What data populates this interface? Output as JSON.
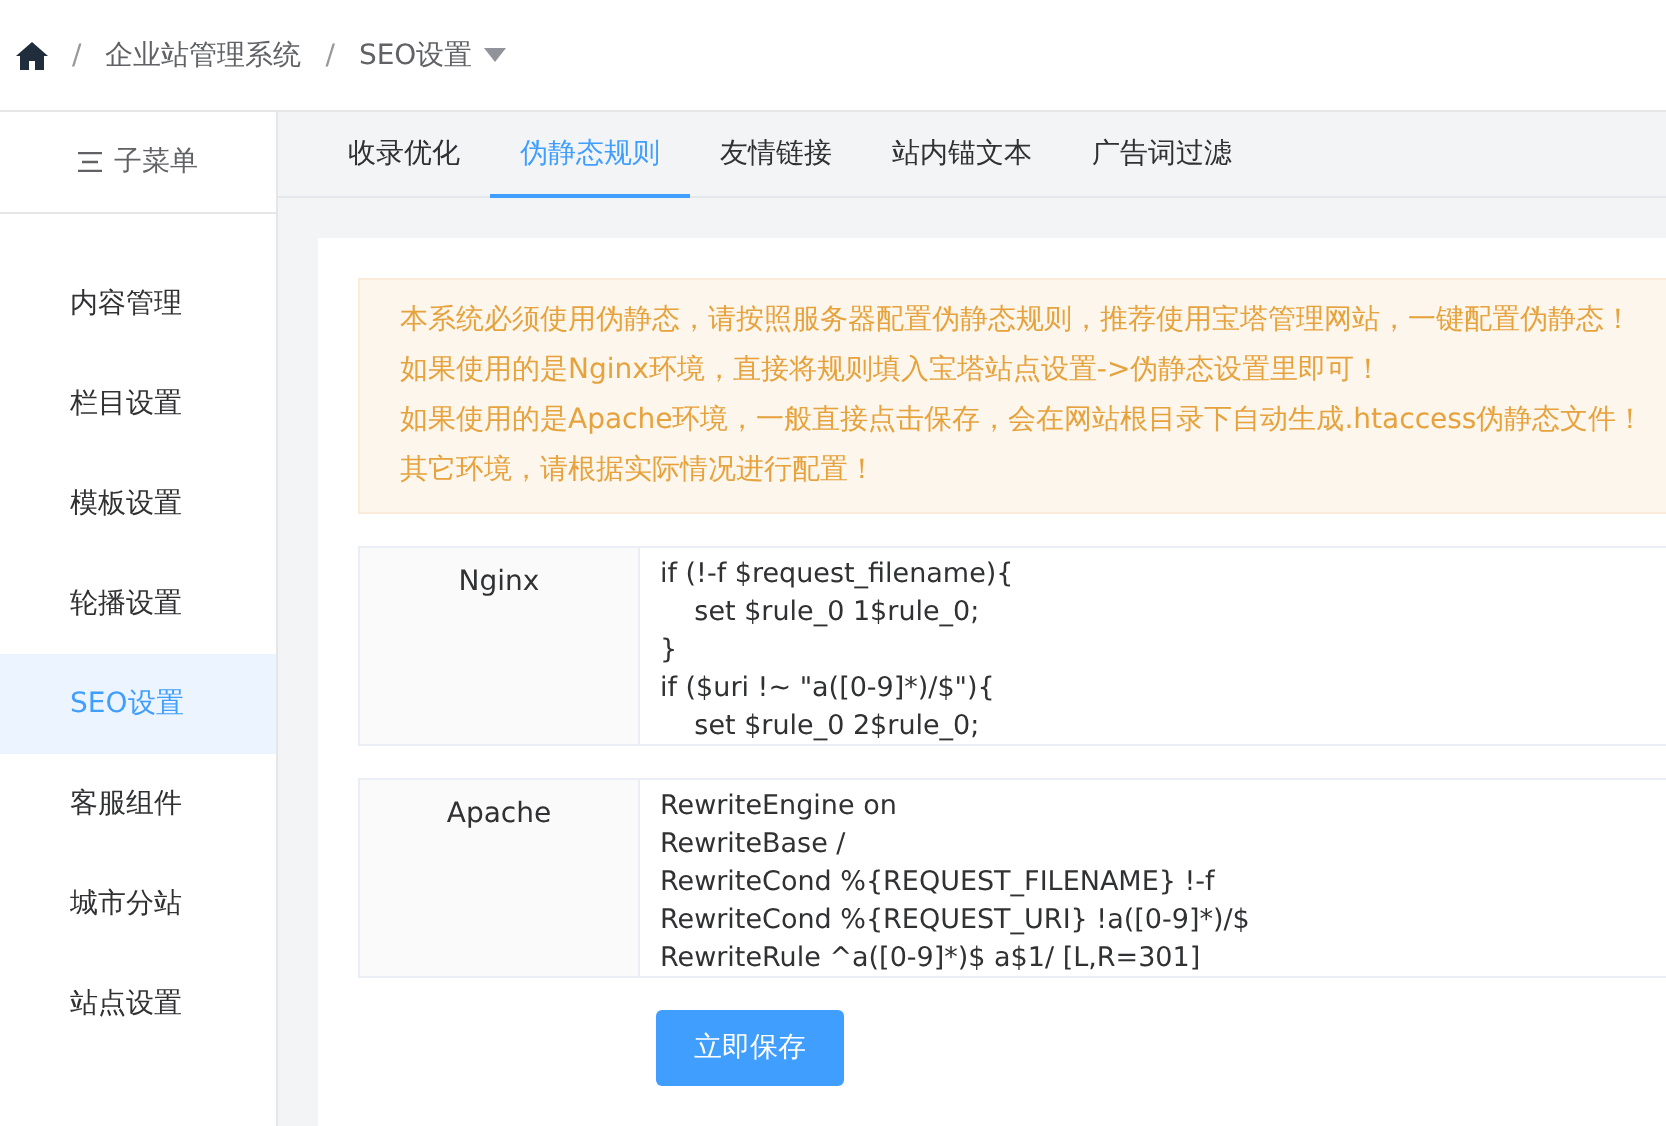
{
  "breadcrumb": {
    "items": [
      "企业站管理系统",
      "SEO设置"
    ],
    "separator": "/"
  },
  "sidebar": {
    "title": "子菜单",
    "items": [
      {
        "label": "内容管理",
        "selected": false
      },
      {
        "label": "栏目设置",
        "selected": false
      },
      {
        "label": "模板设置",
        "selected": false
      },
      {
        "label": "轮播设置",
        "selected": false
      },
      {
        "label": "SEO设置",
        "selected": true
      },
      {
        "label": "客服组件",
        "selected": false
      },
      {
        "label": "城市分站",
        "selected": false
      },
      {
        "label": "站点设置",
        "selected": false
      }
    ]
  },
  "tabs": [
    {
      "label": "收录优化",
      "selected": false
    },
    {
      "label": "伪静态规则",
      "selected": true
    },
    {
      "label": "友情链接",
      "selected": false
    },
    {
      "label": "站内锚文本",
      "selected": false
    },
    {
      "label": "广告词过滤",
      "selected": false
    }
  ],
  "notice": [
    "本系统必须使用伪静态，请按照服务器配置伪静态规则，推荐使用宝塔管理网站，一键配置伪静态！",
    "如果使用的是Nginx环境，直接将规则填入宝塔站点设置->伪静态设置里即可！",
    "如果使用的是Apache环境，一般直接点击保存，会在网站根目录下自动生成.htaccess伪静态文件！",
    "其它环境，请根据实际情况进行配置！"
  ],
  "rules": [
    {
      "label": "Nginx",
      "value": "if (!-f $request_filename){\n    set $rule_0 1$rule_0;\n}\nif ($uri !~ \"a([0-9]*)/$\"){\n    set $rule_0 2$rule_0;"
    },
    {
      "label": "Apache",
      "value": "RewriteEngine on\nRewriteBase /\nRewriteCond %{REQUEST_FILENAME} !-f\nRewriteCond %{REQUEST_URI} !a([0-9]*)/$\nRewriteRule ^a([0-9]*)$ a$1/ [L,R=301]"
    }
  ],
  "save_button": "立即保存"
}
